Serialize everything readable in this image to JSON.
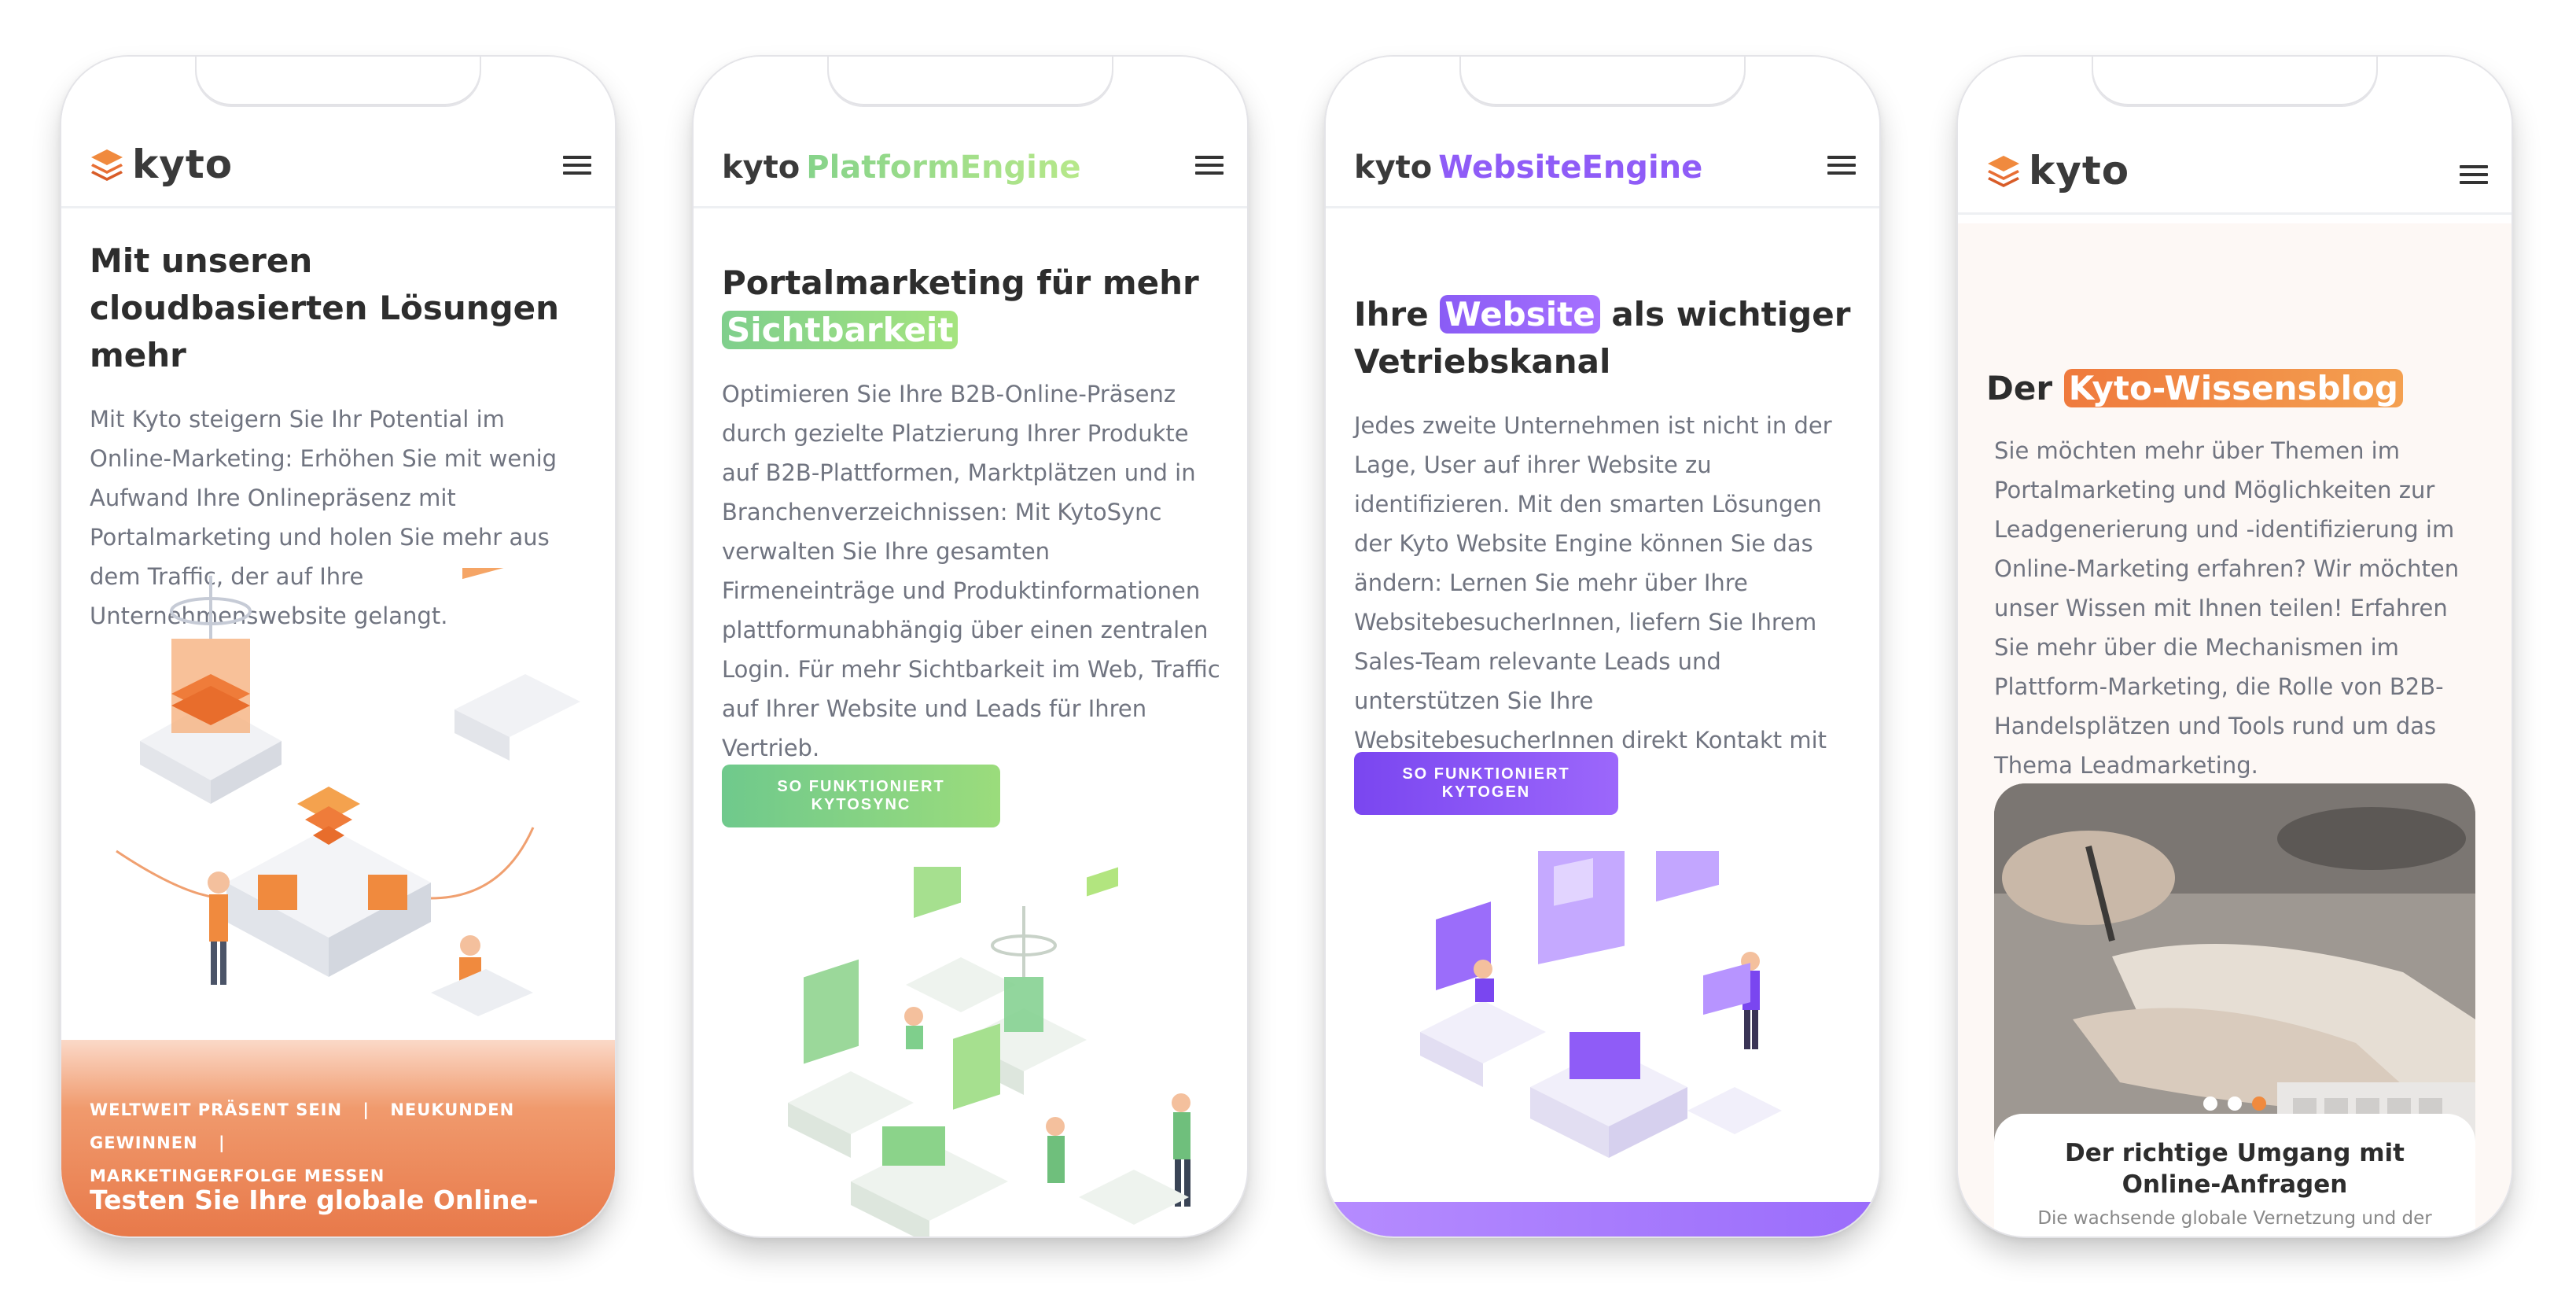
{
  "phones": [
    {
      "logo_text": "kyto",
      "headline": "Mit unseren cloudbasierten Lösungen mehr",
      "body": "Mit Kyto steigern Sie Ihr Potential im Online-Marketing: Erhöhen Sie mit wenig Aufwand Ihre Onlinepräsenz mit Portalmarketing und holen Sie mehr aus dem Traffic, der auf Ihre Unternehmenswebsite gelangt.",
      "band_links": [
        "WELTWEIT PRÄSENT SEIN",
        "NEUKUNDEN GEWINNEN",
        "MARKETINGERFOLGE MESSEN"
      ],
      "band_separator": "|",
      "band_title": "Testen Sie Ihre globale Online-"
    },
    {
      "logo_kyto": "kyto",
      "logo_accent": "PlatformEngine",
      "headline_start": "Portalmarketing für mehr",
      "headline_highlight": "Sichtbarkeit",
      "body": "Optimieren Sie Ihre B2B-Online-Präsenz durch gezielte Platzierung Ihrer Produkte auf B2B-Plattformen, Marktplätzen und in Branchenverzeichnissen: Mit KytoSync verwalten Sie Ihre gesamten Firmeneinträge und Produktinformationen plattformunabhängig über einen zentralen Login. Für mehr Sichtbarkeit im Web, Traffic auf Ihrer Website und Leads für Ihren Vertrieb.",
      "cta": "SO FUNKTIONIERT KYTOSYNC"
    },
    {
      "logo_kyto": "kyto",
      "logo_accent": "WebsiteEngine",
      "headline_start": "Ihre",
      "headline_highlight": "Website",
      "headline_end": "als wichtiger Vetriebskanal",
      "body": "Jedes zweite Unternehmen ist nicht in der Lage, User auf ihrer Website zu identifizieren. Mit den smarten Lösungen der Kyto Website Engine können Sie das ändern: Lernen Sie mehr über Ihre WebsitebesucherInnen, liefern Sie Ihrem Sales-Team relevante Leads und unterstützen Sie Ihre WebsitebesucherInnen direkt Kontakt mit Ihnen aufzunehmen.",
      "cta": "SO FUNKTIONIERT KYTOGEN"
    },
    {
      "logo_text": "kyto",
      "headline_start": "Der",
      "headline_highlight": "Kyto-Wissensblog",
      "body": "Sie möchten mehr über Themen im Portalmarketing und Möglichkeiten zur Leadgenerierung und -identifizierung im Online-Marketing erfahren? Wir möchten unser Wissen mit Ihnen teilen! Erfahren Sie mehr über die Mechanismen im Plattform-Marketing, die Rolle von B2B-Handelsplätzen und Tools rund um das Thema Leadmarketing.",
      "card_title": "Der richtige Umgang mit Online-Anfragen",
      "card_sub": "Die wachsende globale Vernetzung und der",
      "slider_active_index": 3,
      "slider_count": 3
    }
  ],
  "colors": {
    "orange": "#e8794a",
    "green": "#8cd784",
    "purple": "#8f5cf7",
    "text_dark": "#2d2d2d",
    "text_body": "#707480"
  }
}
